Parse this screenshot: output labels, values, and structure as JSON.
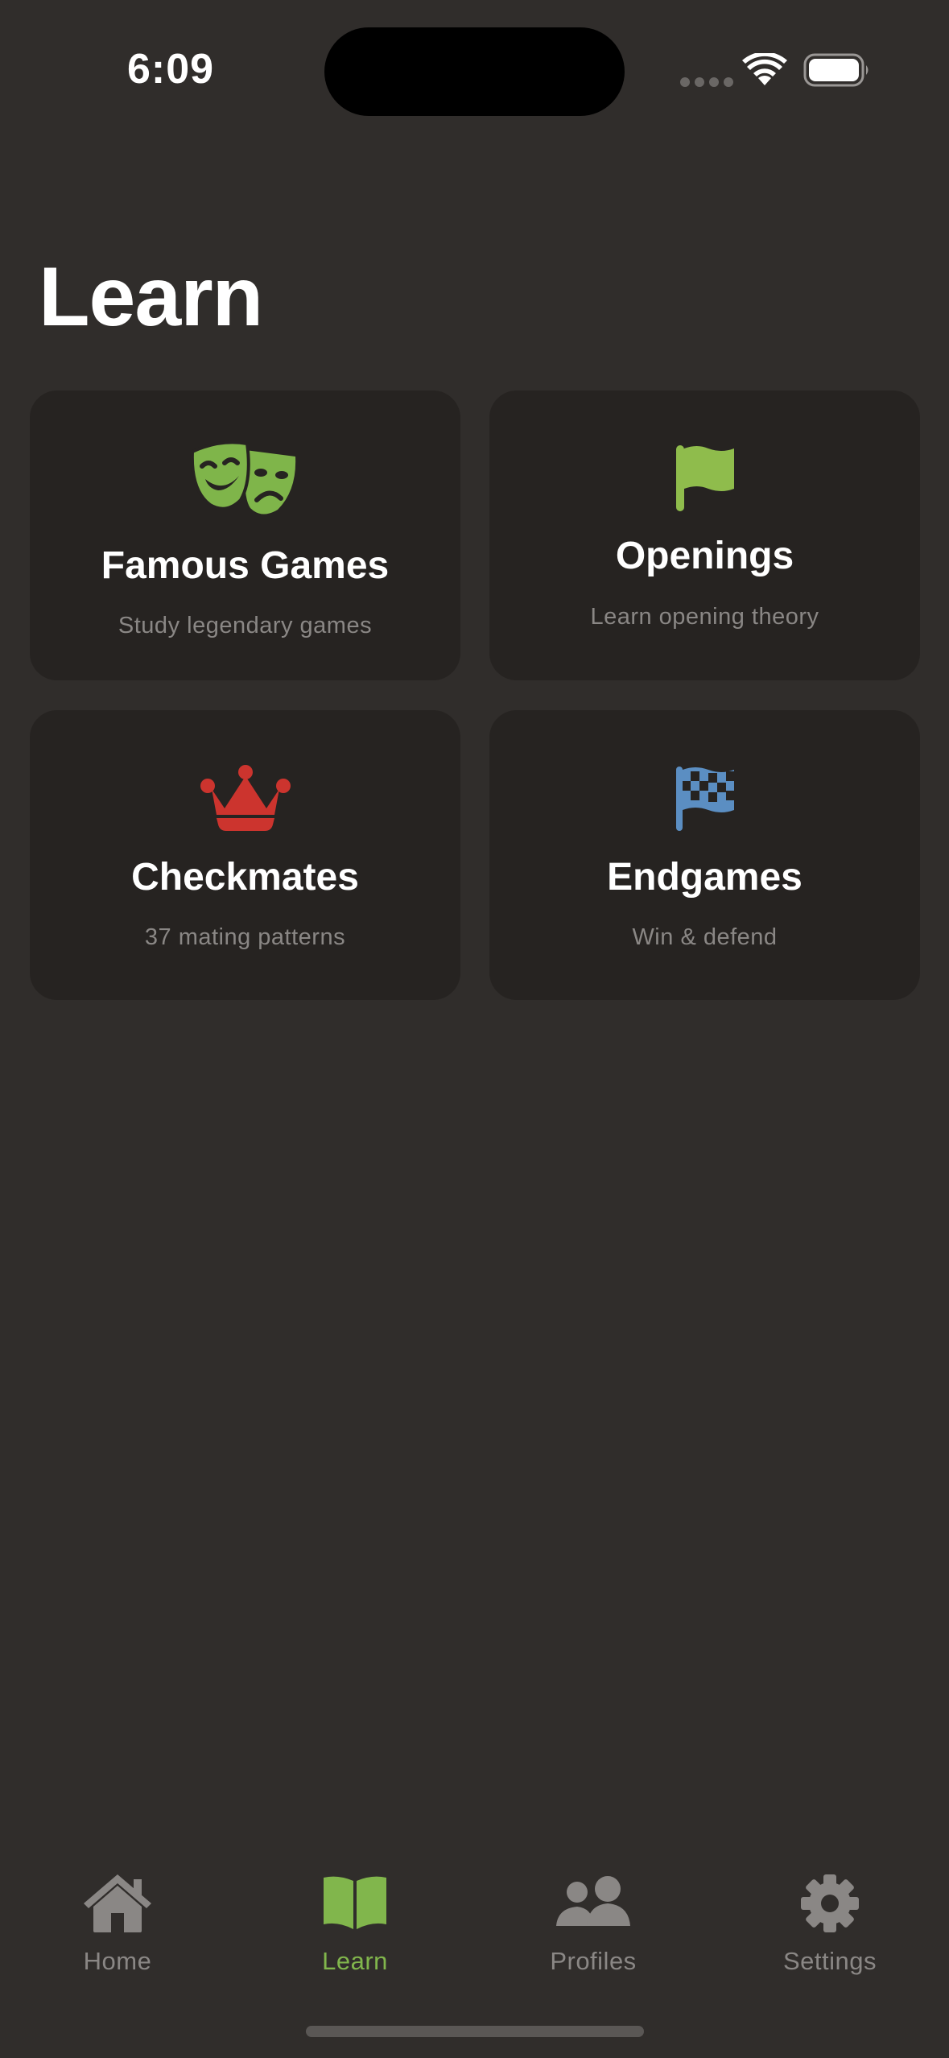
{
  "status_bar": {
    "time": "6:09"
  },
  "page": {
    "title": "Learn"
  },
  "cards": [
    {
      "title": "Famous Games",
      "subtitle": "Study legendary games",
      "icon": "theater-masks-icon",
      "icon_color": "#7fb54a"
    },
    {
      "title": "Openings",
      "subtitle": "Learn opening theory",
      "icon": "flag-icon",
      "icon_color": "#8fbc4c"
    },
    {
      "title": "Checkmates",
      "subtitle": "37 mating patterns",
      "icon": "crown-icon",
      "icon_color": "#cc342e"
    },
    {
      "title": "Endgames",
      "subtitle": "Win & defend",
      "icon": "checkered-flag-icon",
      "icon_color": "#5b8ec2"
    }
  ],
  "tab_bar": {
    "active": "Learn",
    "active_color": "#81b64c",
    "inactive_color": "#8a8785",
    "tabs": [
      {
        "label": "Home",
        "icon": "home-icon"
      },
      {
        "label": "Learn",
        "icon": "book-icon"
      },
      {
        "label": "Profiles",
        "icon": "users-icon"
      },
      {
        "label": "Settings",
        "icon": "gear-icon"
      }
    ]
  },
  "colors": {
    "background": "#302d2b",
    "card_background": "#262321",
    "subtitle_text": "#8a8785"
  }
}
